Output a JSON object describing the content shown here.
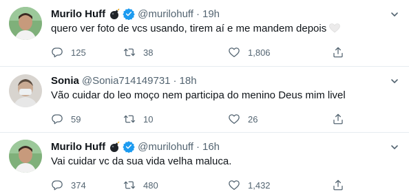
{
  "tweets": [
    {
      "name": "Murilo Huff",
      "handle": "@murilohuff",
      "time": "19h",
      "text": "quero ver foto de vcs usando, tirem aí e me mandem depois",
      "has_heart_emoji": true,
      "replies": "125",
      "retweets": "38",
      "likes": "1,806"
    },
    {
      "name": "Sonia",
      "handle": "@Sonia714149731",
      "time": "18h",
      "text": "Vão cuidar do leo moço nem participa do menino Deus mim livel",
      "replies": "59",
      "retweets": "10",
      "likes": "26"
    },
    {
      "name": "Murilo Huff",
      "handle": "@murilohuff",
      "time": "16h",
      "text": "Vai cuidar vc da sua vida velha maluca.",
      "replies": "374",
      "retweets": "480",
      "likes": "1,432"
    }
  ],
  "dot": "·",
  "icons": {
    "reply": "reply-icon",
    "retweet": "retweet-icon",
    "like": "heart-icon",
    "share": "share-icon",
    "more": "more-options-icon",
    "verified": "verified-badge-icon",
    "bomb": "bomb-emoji-icon"
  },
  "colors": {
    "text": "#0f1419",
    "secondary": "#536471",
    "verified": "#1d9bf0",
    "divider": "#e6ecf0"
  }
}
